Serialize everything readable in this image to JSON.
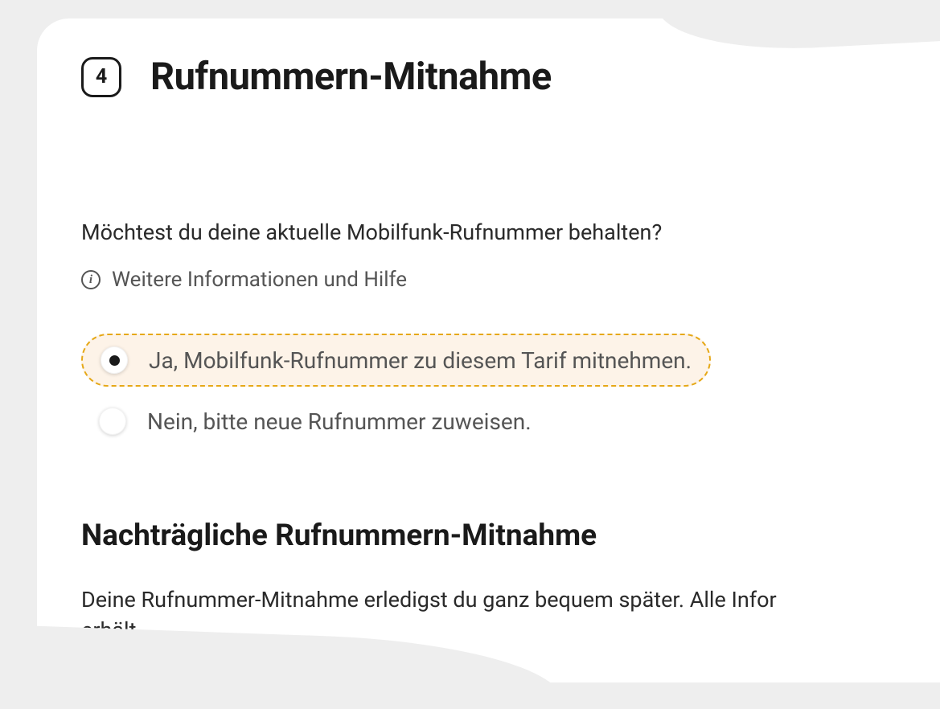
{
  "step": {
    "number": "4",
    "title": "Rufnummern-Mitnahme"
  },
  "question": "Möchtest du deine aktuelle Mobilfunk-Rufnummer behalten?",
  "info_link": "Weitere Informationen und Hilfe",
  "options": {
    "yes": "Ja, Mobilfunk-Rufnummer zu diesem Tarif mitnehmen.",
    "no": "Nein, bitte neue Rufnummer zuweisen."
  },
  "sub": {
    "heading": "Nachträgliche Rufnummern-Mitnahme",
    "text1": "Deine Rufnummer-Mitnahme erledigst du ganz bequem später. Alle Infor",
    "text2": "erhält"
  }
}
